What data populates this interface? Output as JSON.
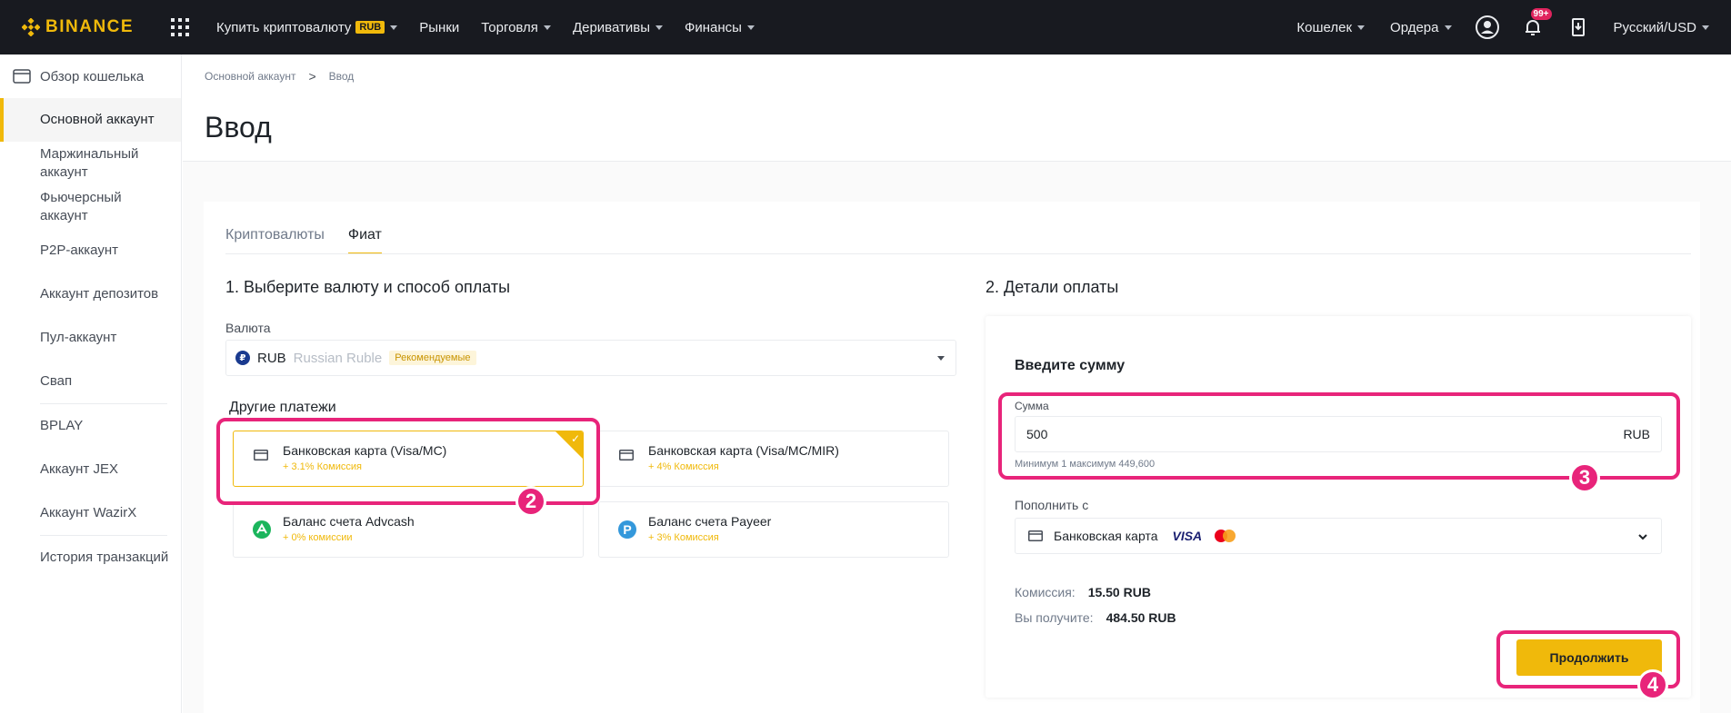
{
  "topbar": {
    "logo": "BINANCE",
    "nav": [
      {
        "label": "Купить криптовалюту",
        "badge": "RUB",
        "caret": true
      },
      {
        "label": "Рынки",
        "caret": false
      },
      {
        "label": "Торговля",
        "caret": true
      },
      {
        "label": "Деривативы",
        "caret": true
      },
      {
        "label": "Финансы",
        "caret": true
      }
    ],
    "right": {
      "wallet": "Кошелек",
      "orders": "Ордера",
      "notifications_count": "99+",
      "language": "Русский/USD"
    }
  },
  "sidebar": {
    "overview": "Обзор кошелька",
    "items": [
      {
        "label": "Основной аккаунт",
        "active": true
      },
      {
        "label": "Маржинальный аккаунт"
      },
      {
        "label": "Фьючерсный аккаунт"
      },
      {
        "label": "P2P-аккаунт"
      },
      {
        "label": "Аккаунт депозитов"
      },
      {
        "label": "Пул-аккаунт"
      },
      {
        "label": "Свап"
      },
      {
        "label": "BPLAY"
      },
      {
        "label": "Аккаунт JEX"
      },
      {
        "label": "Аккаунт WazirX"
      },
      {
        "label": "История транзакций"
      }
    ]
  },
  "breadcrumb": {
    "parent": "Основной аккаунт",
    "sep": ">",
    "current": "Ввод"
  },
  "page_title": "Ввод",
  "tabs": [
    {
      "label": "Криптовалюты",
      "active": false
    },
    {
      "label": "Фиат",
      "active": true
    }
  ],
  "left": {
    "section_title": "1. Выберите валюту и способ оплаты",
    "currency_label": "Валюта",
    "currency": {
      "symbol": "₽",
      "code": "RUB",
      "name": "Russian Ruble",
      "badge": "Рекомендуемые"
    },
    "other_payments_label": "Другие платежи",
    "payment_options": [
      {
        "name": "Банковская карта (Visa/MC)",
        "fee": "+ 3.1% Комиссия",
        "selected": true,
        "icon": "card-icon"
      },
      {
        "name": "Банковская карта (Visa/MC/MIR)",
        "fee": "+ 4% Комиссия",
        "selected": false,
        "icon": "card-icon"
      },
      {
        "name": "Баланс счета Advcash",
        "fee": "+ 0% комиссии",
        "selected": false,
        "icon": "advcash-icon"
      },
      {
        "name": "Баланс счета Payeer",
        "fee": "+ 3% Комиссия",
        "selected": false,
        "icon": "payeer-icon"
      }
    ]
  },
  "right": {
    "section_title": "2. Детали оплаты",
    "enter_amount_title": "Введите сумму",
    "amount_label": "Сумма",
    "amount_value": "500",
    "amount_currency": "RUB",
    "amount_hint": "Минимум 1 максимум 449,600",
    "source_label": "Пополнить с",
    "source_value": "Банковская карта",
    "source_visa": "VISA",
    "fee_label": "Комиссия:",
    "fee_value": "15.50 RUB",
    "receive_label": "Вы получите:",
    "receive_value": "484.50 RUB",
    "continue_label": "Продолжить"
  },
  "annotations": {
    "step2": "2",
    "step3": "3",
    "step4": "4"
  },
  "colors": {
    "accent": "#f0b90b",
    "topbar": "#181a20",
    "annotation": "#e8247a"
  }
}
